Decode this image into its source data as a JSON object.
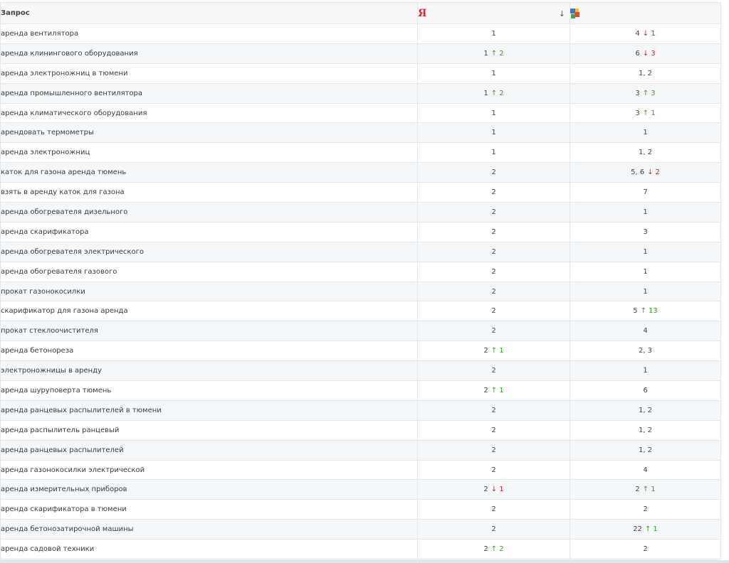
{
  "header": {
    "query_label": "Запрос",
    "yandex_logo": "Я",
    "sort_indicator": "↓",
    "google_icon": "google-icon"
  },
  "rows": [
    {
      "query": "аренда вентилятора",
      "yandex": "1",
      "yandex_change": null,
      "google": "4",
      "google_change": {
        "dir": "down",
        "value": "1"
      }
    },
    {
      "query": "аренда клинингового оборудования",
      "yandex": "1",
      "yandex_change": {
        "dir": "up",
        "value": "2"
      },
      "google": "6",
      "google_change": {
        "dir": "down",
        "value": "3"
      }
    },
    {
      "query": "аренда электроножниц в тюмени",
      "yandex": "1",
      "yandex_change": null,
      "google": "1, 2",
      "google_change": null
    },
    {
      "query": "аренда промышленного вентилятора",
      "yandex": "1",
      "yandex_change": {
        "dir": "up",
        "value": "2"
      },
      "google": "3",
      "google_change": {
        "dir": "up",
        "value": "3"
      }
    },
    {
      "query": "аренда климатического оборудования",
      "yandex": "1",
      "yandex_change": null,
      "google": "3",
      "google_change": {
        "dir": "up",
        "value": "1"
      }
    },
    {
      "query": "арендовать термометры",
      "yandex": "1",
      "yandex_change": null,
      "google": "1",
      "google_change": null
    },
    {
      "query": "аренда электроножниц",
      "yandex": "1",
      "yandex_change": null,
      "google": "1, 2",
      "google_change": null
    },
    {
      "query": "каток для газона аренда тюмень",
      "yandex": "2",
      "yandex_change": null,
      "google": "5, 6",
      "google_change": {
        "dir": "down",
        "value": "2"
      }
    },
    {
      "query": "взять в аренду каток для газона",
      "yandex": "2",
      "yandex_change": null,
      "google": "7",
      "google_change": null
    },
    {
      "query": "аренда обогревателя дизельного",
      "yandex": "2",
      "yandex_change": null,
      "google": "1",
      "google_change": null
    },
    {
      "query": "аренда скарификатора",
      "yandex": "2",
      "yandex_change": null,
      "google": "3",
      "google_change": null
    },
    {
      "query": "аренда обогревателя электрического",
      "yandex": "2",
      "yandex_change": null,
      "google": "1",
      "google_change": null
    },
    {
      "query": "аренда обогревателя газового",
      "yandex": "2",
      "yandex_change": null,
      "google": "1",
      "google_change": null
    },
    {
      "query": "прокат газонокосилки",
      "yandex": "2",
      "yandex_change": null,
      "google": "1",
      "google_change": null
    },
    {
      "query": "скарификатор для газона аренда",
      "yandex": "2",
      "yandex_change": null,
      "google": "5",
      "google_change": {
        "dir": "up",
        "value": "13"
      }
    },
    {
      "query": "прокат стеклоочистителя",
      "yandex": "2",
      "yandex_change": null,
      "google": "4",
      "google_change": null
    },
    {
      "query": "аренда бетонореза",
      "yandex": "2",
      "yandex_change": {
        "dir": "up",
        "value": "1"
      },
      "google": "2, 3",
      "google_change": null
    },
    {
      "query": "электроножницы в аренду",
      "yandex": "2",
      "yandex_change": null,
      "google": "1",
      "google_change": null
    },
    {
      "query": "аренда шуруповерта тюмень",
      "yandex": "2",
      "yandex_change": {
        "dir": "up",
        "value": "1"
      },
      "google": "6",
      "google_change": null
    },
    {
      "query": "аренда ранцевых распылителей в тюмени",
      "yandex": "2",
      "yandex_change": null,
      "google": "1, 2",
      "google_change": null
    },
    {
      "query": "аренда распылитель ранцевый",
      "yandex": "2",
      "yandex_change": null,
      "google": "1, 2",
      "google_change": null
    },
    {
      "query": "аренда ранцевых распылителей",
      "yandex": "2",
      "yandex_change": null,
      "google": "1, 2",
      "google_change": null
    },
    {
      "query": "аренда газонокосилки электрической",
      "yandex": "2",
      "yandex_change": null,
      "google": "4",
      "google_change": null
    },
    {
      "query": "аренда измерительных приборов",
      "yandex": "2",
      "yandex_change": {
        "dir": "down",
        "value": "1"
      },
      "google": "2",
      "google_change": {
        "dir": "up",
        "value": "1"
      }
    },
    {
      "query": "аренда скарификатора в тюмени",
      "yandex": "2",
      "yandex_change": null,
      "google": "2",
      "google_change": null
    },
    {
      "query": "аренда бетонозатирочной машины",
      "yandex": "2",
      "yandex_change": null,
      "google": "22",
      "google_change": {
        "dir": "up",
        "value": "1"
      }
    },
    {
      "query": "аренда садовой техники",
      "yandex": "2",
      "yandex_change": {
        "dir": "up",
        "value": "2"
      },
      "google": "2",
      "google_change": null
    }
  ],
  "colors": {
    "up": "#36a21e",
    "down": "#d12323",
    "yandex_red": "#e0262e",
    "row_stripe": "#f5f8fa",
    "border": "#e3e7ea"
  }
}
